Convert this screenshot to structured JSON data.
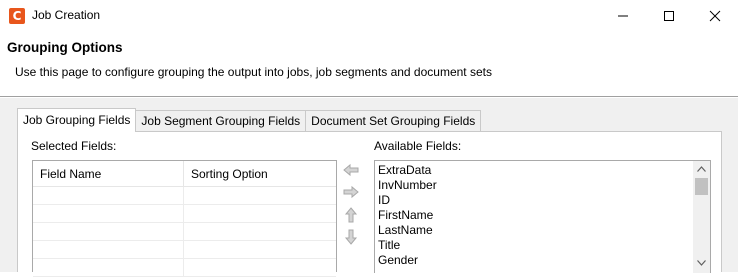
{
  "window": {
    "title": "Job Creation",
    "app_icon_letter": "C",
    "app_icon_color": "#e8561c"
  },
  "header": {
    "title": "Grouping Options",
    "description": "Use this page to configure grouping the output into jobs, job segments and document sets"
  },
  "tabs": [
    {
      "label": "Job Grouping Fields",
      "active": true
    },
    {
      "label": "Job Segment Grouping Fields",
      "active": false
    },
    {
      "label": "Document Set Grouping Fields",
      "active": false
    }
  ],
  "panel": {
    "selected_label": "Selected Fields:",
    "available_label": "Available Fields:",
    "table_columns": [
      "Field Name",
      "Sorting Option"
    ],
    "selected_rows": [],
    "available_fields": [
      "ExtraData",
      "InvNumber",
      "ID",
      "FirstName",
      "LastName",
      "Title",
      "Gender"
    ],
    "move_buttons": [
      "arrow-left-icon",
      "arrow-right-icon",
      "arrow-up-icon",
      "arrow-down-icon"
    ]
  }
}
